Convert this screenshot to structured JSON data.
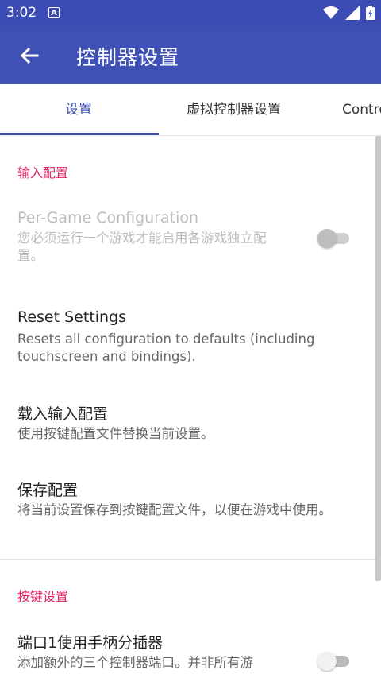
{
  "status_bar": {
    "time": "3:02",
    "notification_badge": "A",
    "icons": [
      "wifi-icon",
      "signal-icon",
      "battery-icon"
    ]
  },
  "app_bar": {
    "title": "控制器设置",
    "back_icon": "arrow-left-icon"
  },
  "tabs": [
    {
      "label": "设置",
      "active": true
    },
    {
      "label": "虚拟控制器设置",
      "active": false
    },
    {
      "label": "Contro",
      "active": false
    }
  ],
  "sections": [
    {
      "header": "输入配置",
      "items": [
        {
          "title": "Per-Game Configuration",
          "subtitle": "您必须运行一个游戏才能启用各游戏独立配置。",
          "switch": false,
          "enabled": false
        },
        {
          "title": "Reset Settings",
          "subtitle": "Resets all configuration to defaults (including touchscreen and bindings)."
        },
        {
          "title": "载入输入配置",
          "subtitle": "使用按键配置文件替换当前设置。"
        },
        {
          "title": "保存配置",
          "subtitle": "将当前设置保存到按键配置文件，以便在游戏中使用。"
        }
      ]
    },
    {
      "header": "按键设置",
      "items": [
        {
          "title": "端口1使用手柄分插器",
          "subtitle": "添加额外的三个控制器端口。并非所有游",
          "switch": false,
          "enabled": true
        }
      ]
    }
  ],
  "colors": {
    "status_bar": "#3b4cb5",
    "app_bar": "#3f51b5",
    "section_header": "#e91e63",
    "tab_active": "#3f51b5"
  }
}
